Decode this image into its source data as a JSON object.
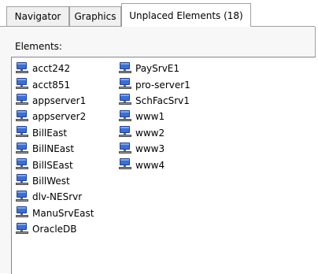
{
  "tabs": [
    {
      "label": "Navigator",
      "active": false
    },
    {
      "label": "Graphics",
      "active": false
    },
    {
      "label": "Unplaced Elements (18)",
      "active": true
    }
  ],
  "panel": {
    "elements_label": "Elements:",
    "icon": "server-computer-icon",
    "columns": [
      [
        "acct242",
        "acct851",
        "appserver1",
        "appserver2",
        "BillEast",
        "BillNEast",
        "BillSEast",
        "BillWest",
        "dlv-NESrvr",
        "ManuSrvEast",
        "OracleDB"
      ],
      [
        "PaySrvE1",
        "pro-server1",
        "SchFacSrv1",
        "www1",
        "www2",
        "www3",
        "www4"
      ]
    ]
  },
  "colors": {
    "tab_border": "#a0a0a0",
    "panel_bg": "#f7f7f7",
    "icon_blue": "#2a57b8"
  }
}
